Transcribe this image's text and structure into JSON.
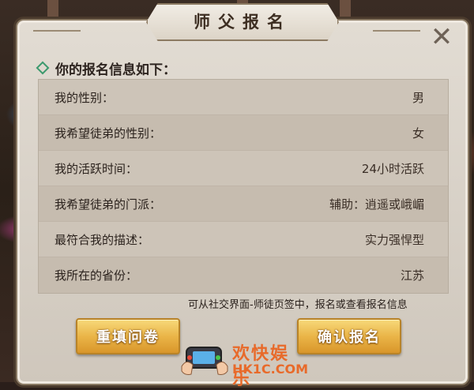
{
  "dialog": {
    "title": "师父报名",
    "close_symbol": "✕",
    "section_header": "你的报名信息如下：",
    "rows": [
      {
        "label": "我的性别：",
        "value": "男"
      },
      {
        "label": "我希望徒弟的性别：",
        "value": "女"
      },
      {
        "label": "我的活跃时间：",
        "value": "24小时活跃"
      },
      {
        "label": "我希望徒弟的门派：",
        "value": "辅助：逍遥或峨嵋"
      },
      {
        "label": "最符合我的描述：",
        "value": "实力强悍型"
      },
      {
        "label": "我所在的省份：",
        "value": "江苏"
      }
    ],
    "hint": "可从社交界面-师徒页签中，报名或查看报名信息",
    "buttons": {
      "refill": "重填问卷",
      "confirm": "确认报名"
    }
  },
  "watermark": {
    "title": "欢快娱乐",
    "site": "HK1C.COM"
  },
  "colors": {
    "accent_green": "#3c9a6e",
    "button_gold": "#eab548",
    "watermark_orange": "#e86a2a"
  }
}
